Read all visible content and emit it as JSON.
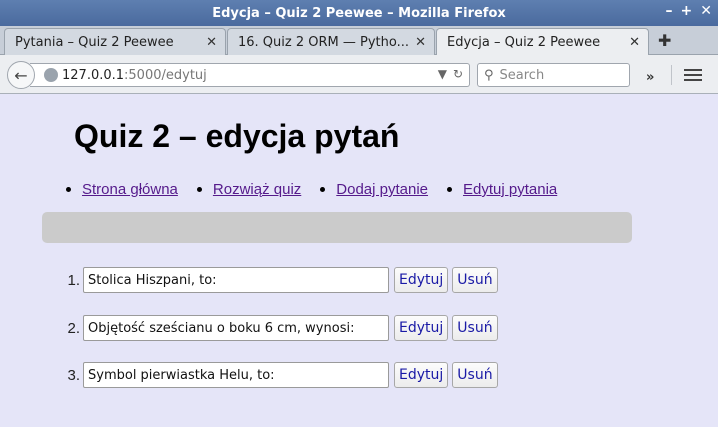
{
  "window": {
    "title": "Edycja – Quiz 2 Peewee – Mozilla Firefox",
    "controls": [
      "–",
      "+",
      "✕"
    ]
  },
  "tabs": [
    {
      "label": "Pytania – Quiz 2 Peewee",
      "active": false
    },
    {
      "label": "16. Quiz 2 ORM — Pytho...",
      "active": false
    },
    {
      "label": "Edycja – Quiz 2 Peewee",
      "active": true
    }
  ],
  "urlbar": {
    "host": "127.0.0.1",
    "rest": ":5000/edytuj"
  },
  "search": {
    "placeholder": "Search"
  },
  "page": {
    "title": "Quiz 2 – edycja pytań",
    "nav": [
      "Strona główna",
      "Rozwiąż quiz",
      "Dodaj pytanie",
      "Edytuj pytania"
    ],
    "questions": [
      {
        "num": "1.",
        "text": "Stolica Hiszpani, to:"
      },
      {
        "num": "2.",
        "text": "Objętość sześcianu o boku 6 cm, wynosi:"
      },
      {
        "num": "3.",
        "text": "Symbol pierwiastka Helu, to:"
      }
    ],
    "edit_label": "Edytuj",
    "delete_label": "Usuń"
  }
}
